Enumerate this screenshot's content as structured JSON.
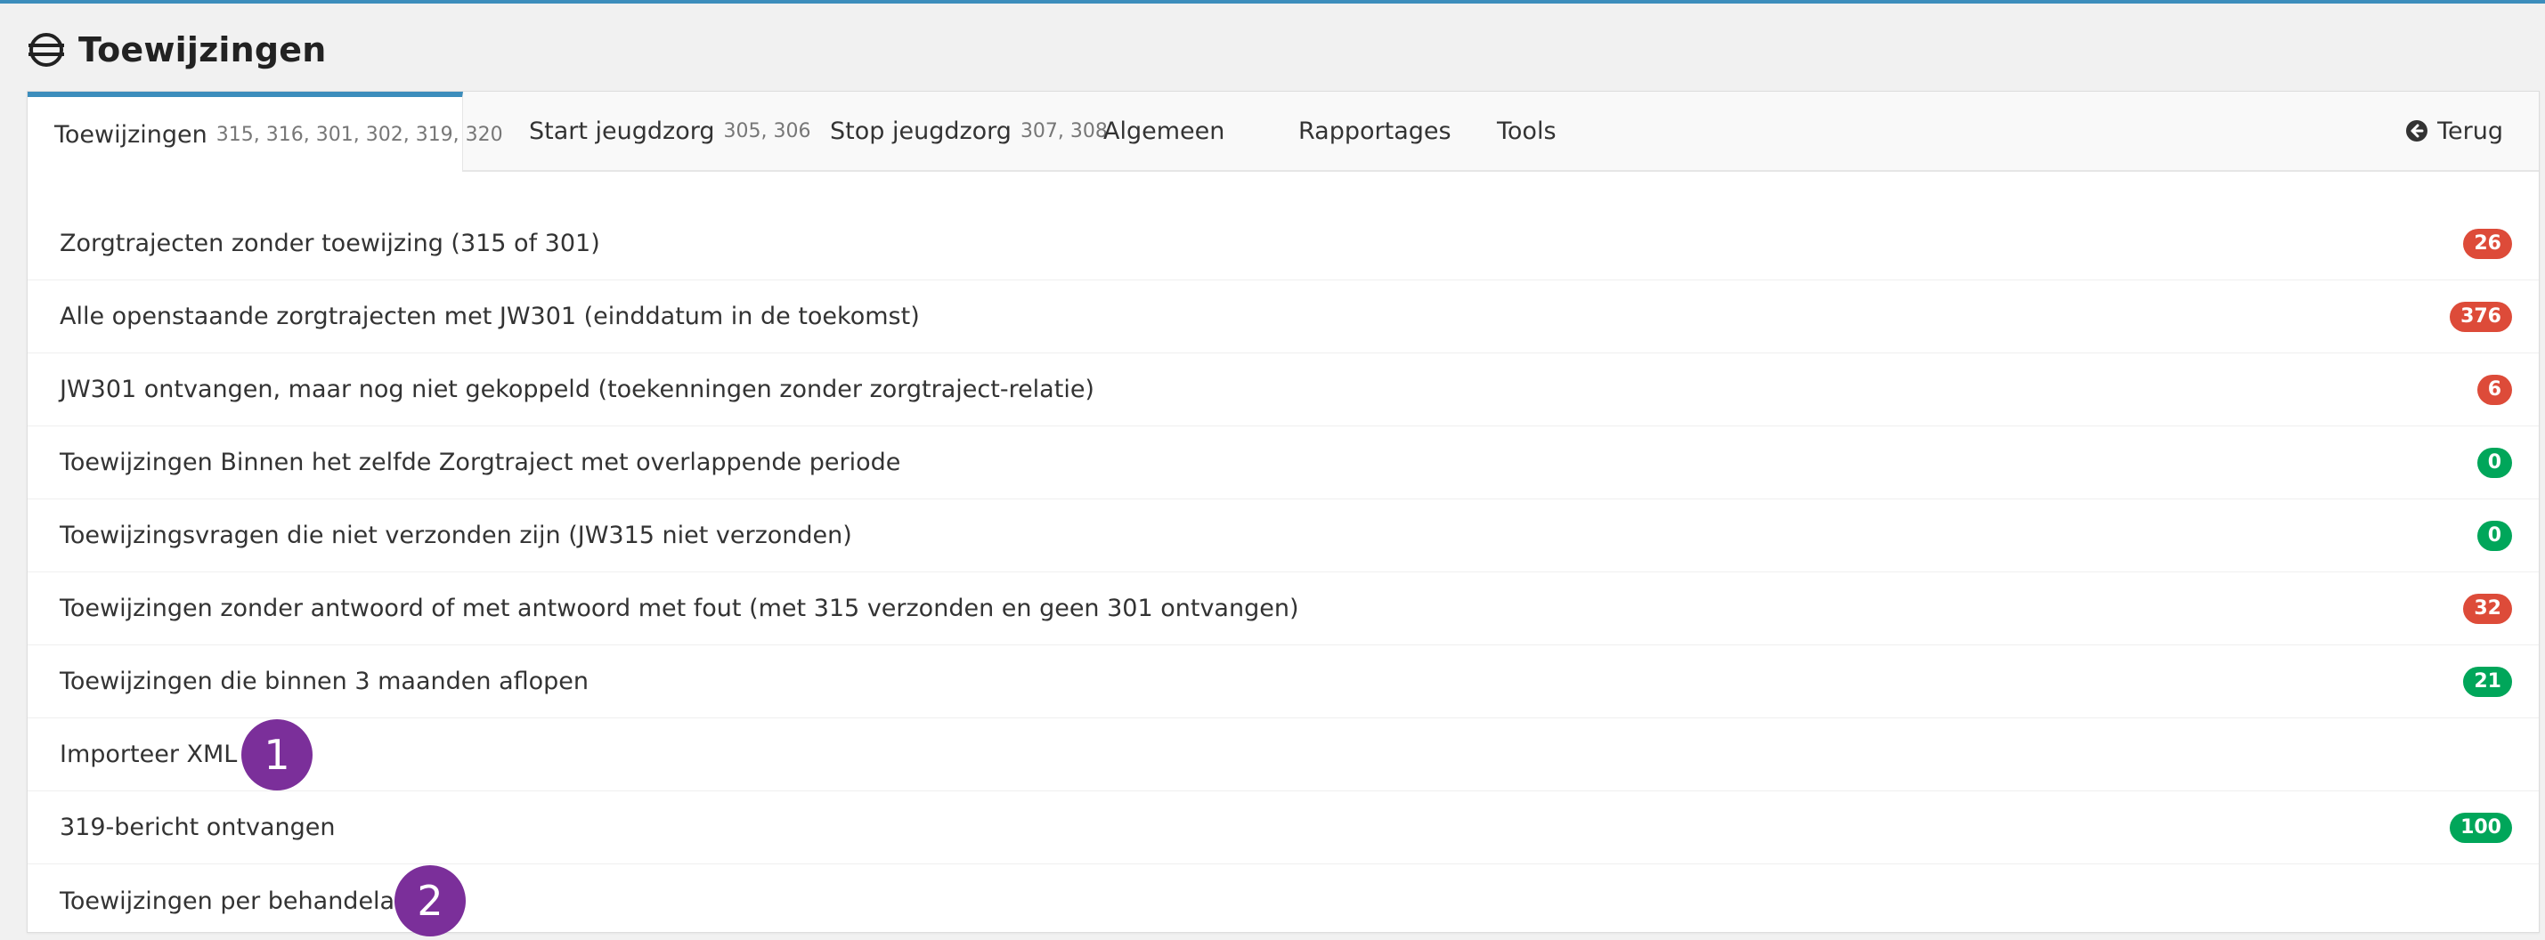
{
  "page": {
    "title": "Toewijzingen",
    "accent": "#3c8dbc"
  },
  "tabs": [
    {
      "label": "Toewijzingen",
      "codes": "315, 316, 301, 302, 319, 320",
      "active": true
    },
    {
      "label": "Start jeugdzorg",
      "codes": "305, 306"
    },
    {
      "label": "Stop jeugdzorg",
      "codes": "307, 308"
    },
    {
      "label": "Algemeen"
    },
    {
      "label": "Rapportages"
    },
    {
      "label": "Tools"
    }
  ],
  "back": {
    "label": "Terug",
    "icon": "arrow-circle-left-icon"
  },
  "colors": {
    "red": "#dd4b39",
    "green": "#00a65a",
    "marker": "#7b2f9a"
  },
  "items": [
    {
      "label": "Zorgtrajecten zonder toewijzing (315 of 301)",
      "count": "26",
      "status": "red"
    },
    {
      "label": "Alle openstaande zorgtrajecten met JW301 (einddatum in de toekomst)",
      "count": "376",
      "status": "red"
    },
    {
      "label": "JW301 ontvangen, maar nog niet gekoppeld (toekenningen zonder zorgtraject-relatie)",
      "count": "6",
      "status": "red"
    },
    {
      "label": "Toewijzingen Binnen het zelfde Zorgtraject met overlappende periode",
      "count": "0",
      "status": "green"
    },
    {
      "label": "Toewijzingsvragen die niet verzonden zijn (JW315 niet verzonden)",
      "count": "0",
      "status": "green"
    },
    {
      "label": "Toewijzingen zonder antwoord of met antwoord met fout (met 315 verzonden en geen 301 ontvangen)",
      "count": "32",
      "status": "red"
    },
    {
      "label": "Toewijzingen die binnen 3 maanden aflopen",
      "count": "21",
      "status": "green"
    },
    {
      "label": "Importeer XML",
      "marker": "1"
    },
    {
      "label": "319-bericht ontvangen",
      "count": "100",
      "status": "green"
    },
    {
      "label": "Toewijzingen per behandelaar",
      "marker": "2"
    }
  ]
}
